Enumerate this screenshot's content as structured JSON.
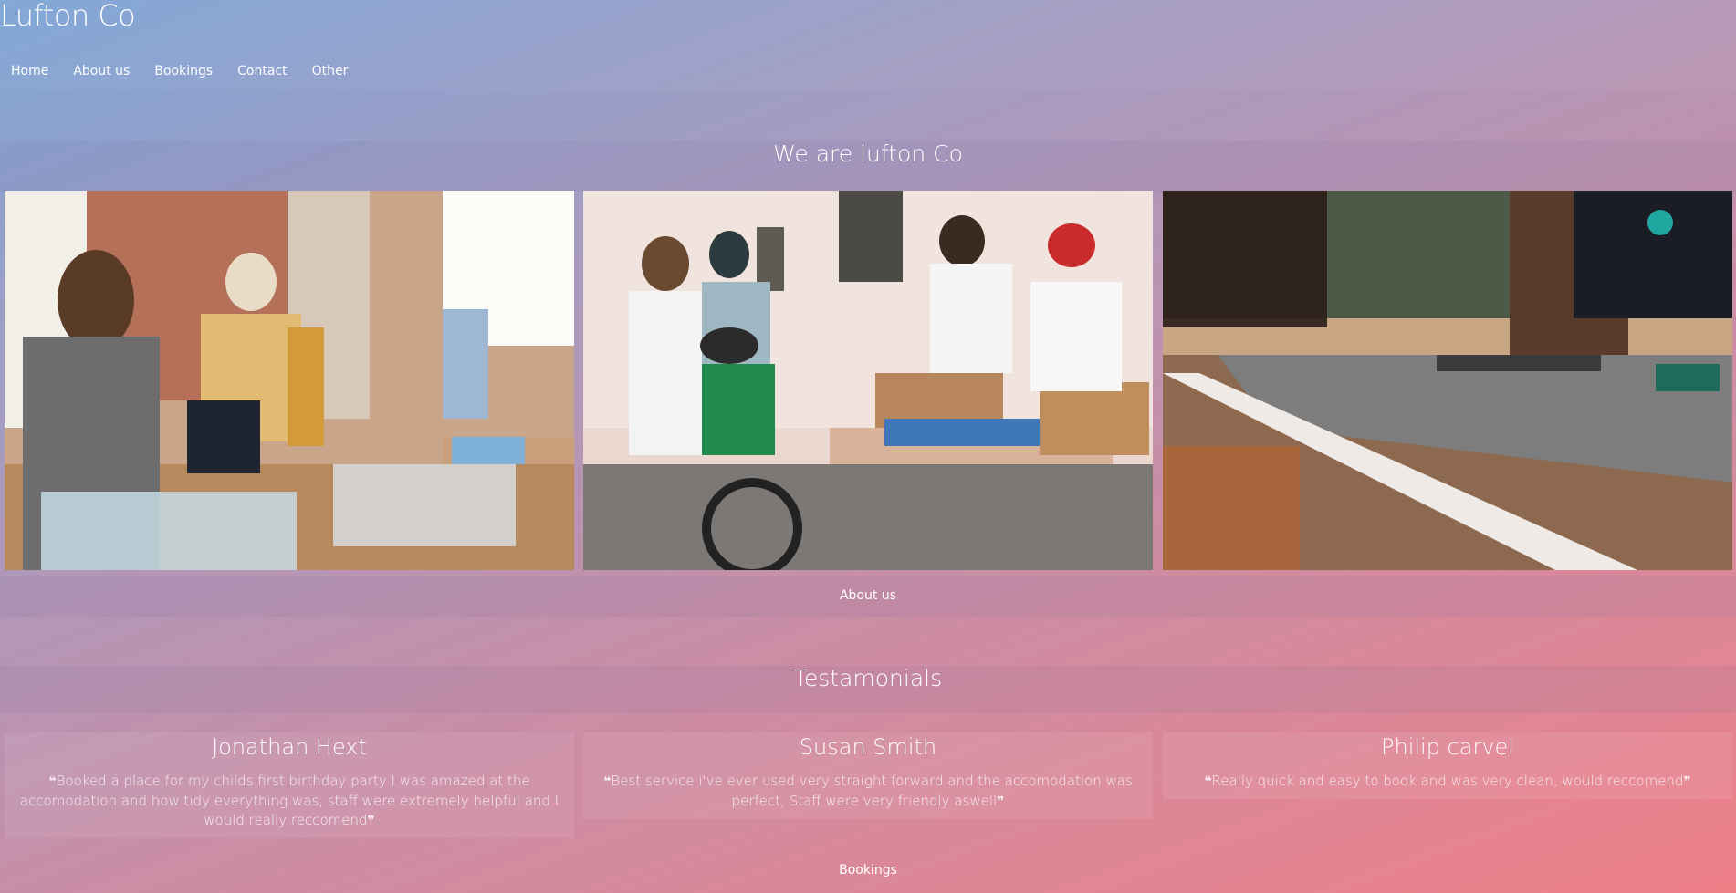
{
  "brand": "Lufton Co",
  "nav": [
    "Home",
    "About us",
    "Bookings",
    "Contact",
    "Other"
  ],
  "hero": {
    "title": "We are lufton Co"
  },
  "about_link": "About us",
  "testimonials": {
    "title": "Testamonials",
    "items": [
      {
        "name": "Jonathan Hext",
        "quote": "Booked a place for my childs first birthday party I was amazed at the accomodation and how tidy everything was, staff were extremely helpful and I would really reccomend"
      },
      {
        "name": "Susan Smith",
        "quote": "Best service i've ever used very straight forward and the accomodation was perfect, Staff were very friendly aswell"
      },
      {
        "name": "Philip carvel",
        "quote": "Really quick and easy to book and was very clean, would reccomend"
      }
    ]
  },
  "bookings_link": "Bookings",
  "colors": {
    "gradient_start": "#7fa6d6",
    "gradient_end": "#ef8088"
  }
}
